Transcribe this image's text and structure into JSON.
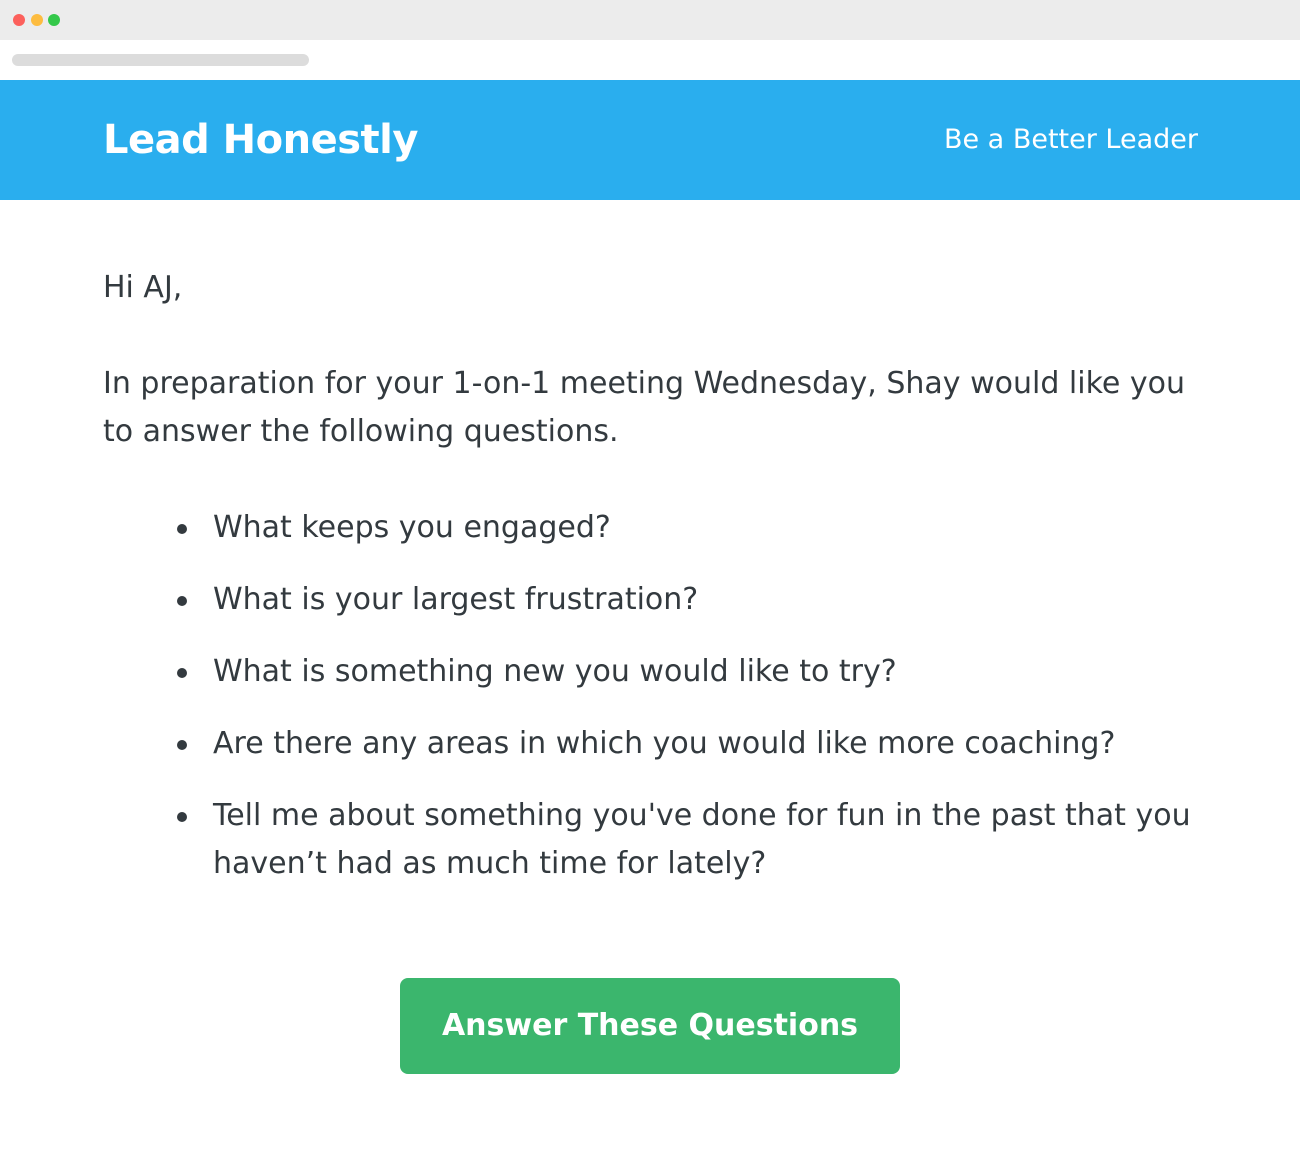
{
  "window": {
    "controls": [
      "close-dot",
      "minimize-dot",
      "zoom-dot"
    ]
  },
  "header": {
    "brand": "Lead Honestly",
    "tagline": "Be a Better Leader",
    "background_color": "#2aaeee"
  },
  "email": {
    "greeting": "Hi AJ,",
    "intro": "In preparation for your 1-on-1 meeting Wednesday, Shay would like you to answer the following questions.",
    "questions": [
      "What keeps you engaged?",
      "What is your largest frustration?",
      "What is something new you would like to try?",
      "Are there any areas in which you would like more coaching?",
      "Tell me about something you've done for fun in the past that you haven’t had as much time for lately?"
    ]
  },
  "cta": {
    "label": "Answer These Questions",
    "color": "#3bb66d"
  }
}
